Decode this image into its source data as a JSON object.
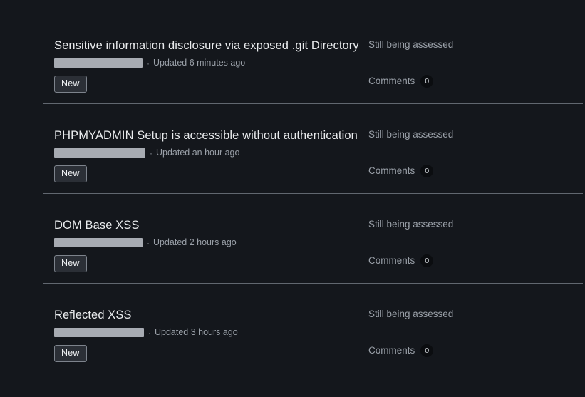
{
  "theme": {
    "background": "#14171c",
    "divider": "#6e757e",
    "title_color": "#e9ebed",
    "muted_color": "#9aa0a8",
    "redacted_color": "#a7abb2",
    "badge_border": "#7d838c",
    "badge_background": "#2b2f36",
    "count_badge_background": "#0b0d10"
  },
  "list": {
    "rows": [
      {
        "title": "Sensitive information disclosure via exposed .git Directory",
        "redacted_width": 124,
        "separator": "·",
        "updated": "Updated 6 minutes ago",
        "tag": "New",
        "status": "Still being assessed",
        "comments_label": "Comments",
        "comments_count": "0"
      },
      {
        "title": "PHPMYADMIN Setup is accessible without authentication",
        "redacted_width": 128,
        "separator": "·",
        "updated": "Updated an hour ago",
        "tag": "New",
        "status": "Still being assessed",
        "comments_label": "Comments",
        "comments_count": "0"
      },
      {
        "title": "DOM Base XSS",
        "redacted_width": 124,
        "separator": "·",
        "updated": "Updated 2 hours ago",
        "tag": "New",
        "status": "Still being assessed",
        "comments_label": "Comments",
        "comments_count": "0"
      },
      {
        "title": "Reflected XSS",
        "redacted_width": 126,
        "separator": "·",
        "updated": "Updated 3 hours ago",
        "tag": "New",
        "status": "Still being assessed",
        "comments_label": "Comments",
        "comments_count": "0"
      }
    ]
  }
}
